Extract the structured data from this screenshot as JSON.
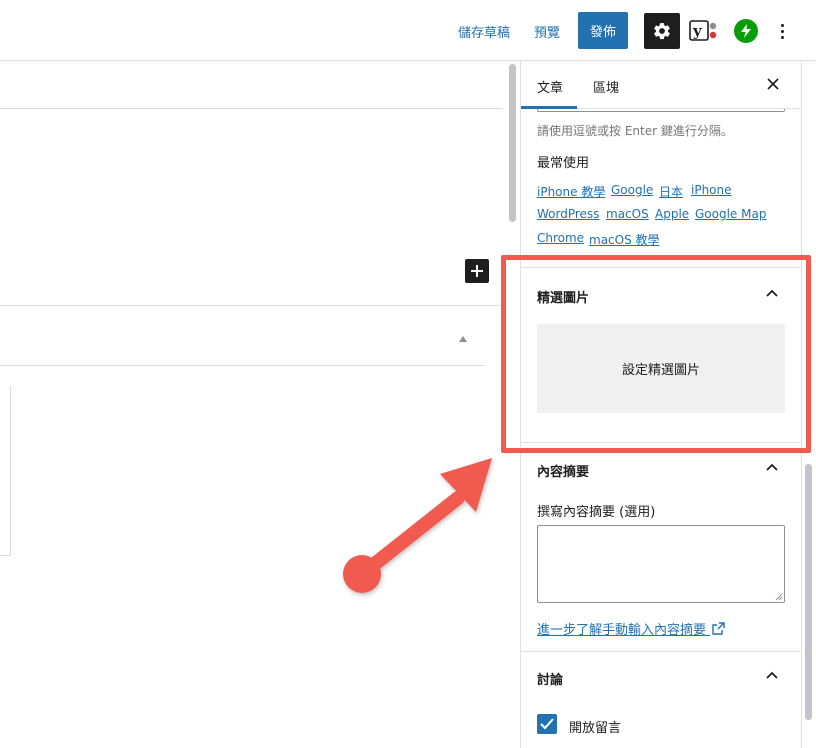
{
  "toolbar": {
    "save_draft": "儲存草稿",
    "preview": "預覽",
    "publish": "發佈",
    "settings_icon": "gear-icon",
    "yoast_icon": "yoast-icon",
    "jetpack_icon": "jetpack-icon",
    "more_icon": "kebab-icon"
  },
  "sidebar": {
    "tabs": [
      {
        "label": "文章",
        "active": true
      },
      {
        "label": "區塊",
        "active": false
      }
    ],
    "tags": {
      "help_text": "請使用逗號或按 Enter 鍵進行分隔。",
      "most_used_label": "最常使用",
      "most_used": [
        "iPhone 教學",
        "Google",
        "日本",
        "iPhone",
        "WordPress",
        "macOS",
        "Apple",
        "Google Map",
        "Chrome",
        "macOS 教學"
      ]
    },
    "featured_image": {
      "title": "精選圖片",
      "button": "設定精選圖片",
      "expanded": true
    },
    "excerpt": {
      "title": "內容摘要",
      "label": "撰寫內容摘要 (選用)",
      "value": "",
      "help_link": "進一步了解手動輸入內容摘要",
      "expanded": true
    },
    "discussion": {
      "title": "討論",
      "allow_comments_label": "開放留言",
      "allow_comments": true,
      "expanded": true
    }
  },
  "colors": {
    "accent": "#2271b1",
    "annotation": "#f05a4f",
    "jetpack_green": "#069e08"
  }
}
